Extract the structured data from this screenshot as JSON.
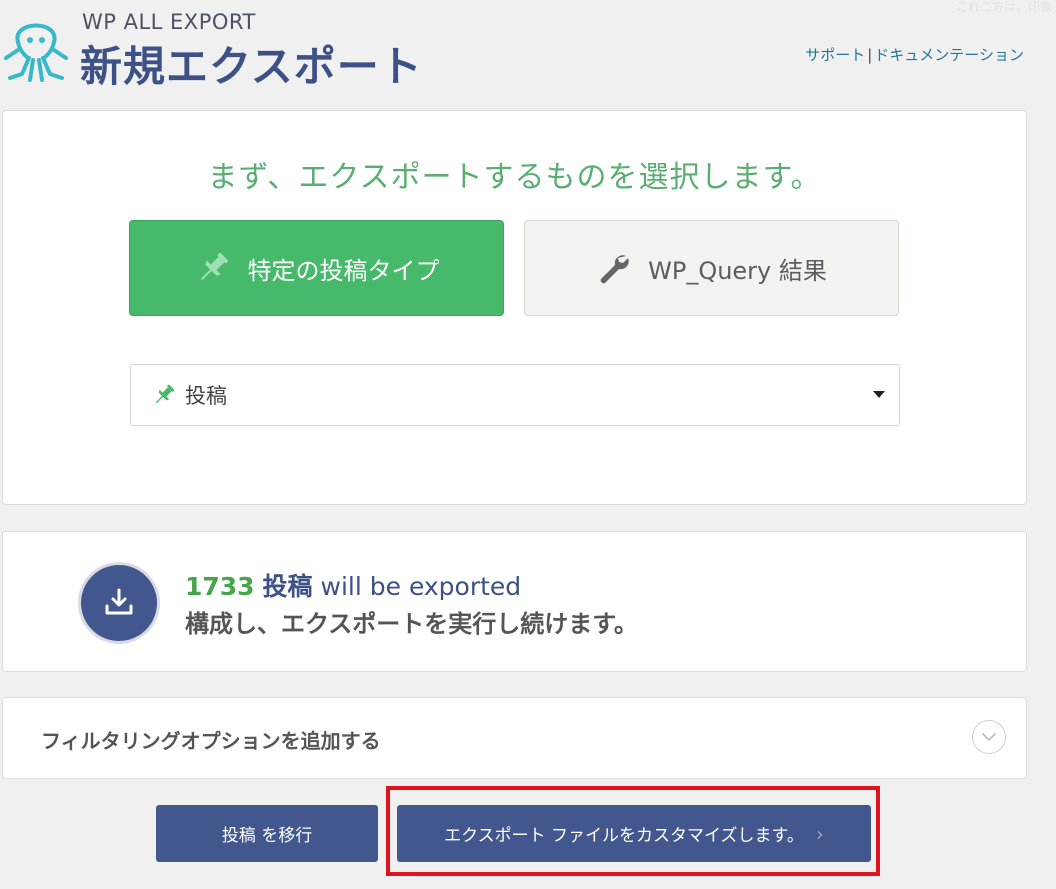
{
  "header": {
    "brand": "WP ALL EXPORT",
    "title": "新規エクスポート",
    "links": [
      "サポート",
      "ドキュメンテーション"
    ],
    "faint_corner": "これ二方は。印象"
  },
  "select_panel": {
    "heading": "まず、エクスポートするものを選択します。",
    "btn_post_type": "特定の投稿タイプ",
    "btn_wp_query": "WP_Query 結果",
    "selected_post_type": "投稿"
  },
  "count_panel": {
    "count": "1733",
    "post_type": "投稿",
    "will_be": "will be exported",
    "sub": "構成し、エクスポートを実行し続けます。"
  },
  "filter_panel": {
    "label": "フィルタリングオプションを追加する"
  },
  "buttons": {
    "migrate": "投稿 を移行",
    "customize": "エクスポート ファイルをカスタマイズします。",
    "customize_chevron": "›"
  },
  "colors": {
    "green": "#46b96a",
    "navy": "#41578e",
    "highlight": "#e0141e"
  }
}
